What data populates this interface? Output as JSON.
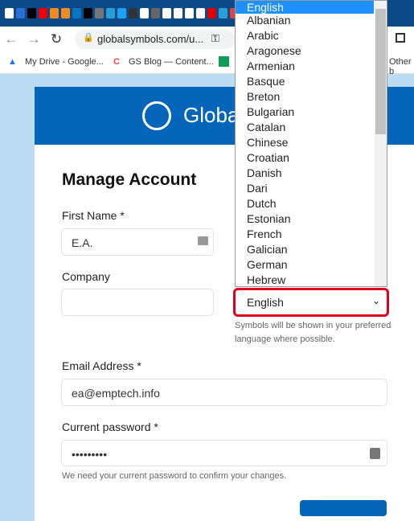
{
  "browser": {
    "url": "globalsymbols.com/u...",
    "bookmarks": [
      "My Drive - Google...",
      "GS Blog — Content...",
      "Other b"
    ],
    "favicon_colors": [
      "#fff",
      "#2a6fd6",
      "#000",
      "#e00",
      "#f08a24",
      "#f08a24",
      "#0a74c4",
      "#000",
      "#777",
      "#2a9fd6",
      "#1da1f2",
      "#333",
      "#fff",
      "#666",
      "#fff",
      "#fff",
      "#fff",
      "#fff",
      "#d00",
      "#2a9fd6",
      "#d44"
    ]
  },
  "header": {
    "brand": "Global"
  },
  "form": {
    "title": "Manage Account",
    "first_name_label": "First Name *",
    "first_name_value": "E.A.",
    "company_label": "Company",
    "company_value": "",
    "language_value": "English",
    "language_help": "Symbols will be shown in your preferred language where possible.",
    "email_label": "Email Address *",
    "email_value": "ea@emptech.info",
    "password_label": "Current password *",
    "password_value": "•••••••••",
    "password_help": "We need your current password to confirm your changes."
  },
  "dropdown": {
    "options": [
      "English",
      "Albanian",
      "Arabic",
      "Aragonese",
      "Armenian",
      "Basque",
      "Breton",
      "Bulgarian",
      "Catalan",
      "Chinese",
      "Croatian",
      "Danish",
      "Dari",
      "Dutch",
      "Estonian",
      "French",
      "Galician",
      "German",
      "Hebrew"
    ],
    "selected": "English",
    "highlight_color": "#e00016"
  }
}
